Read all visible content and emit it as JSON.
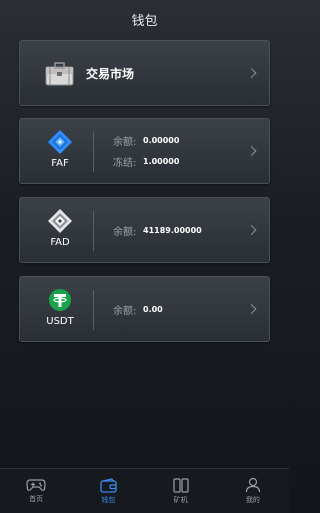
{
  "header": {
    "title": "钱包"
  },
  "market": {
    "title": "交易市场",
    "icon": "briefcase-icon"
  },
  "coins": [
    {
      "name": "FAF",
      "icon": "faf-logo",
      "balance_label": "余额:",
      "balance": "0.00000",
      "frozen_label": "冻结:",
      "frozen": "1.00000",
      "color": "#2f8fff"
    },
    {
      "name": "FAD",
      "icon": "fad-logo",
      "balance_label": "余额:",
      "balance": "41189.00000",
      "color": "#d8dadd"
    },
    {
      "name": "USDT",
      "icon": "tether-logo",
      "balance_label": "余额:",
      "balance": "0.00",
      "color": "#1aa34a"
    }
  ],
  "tabbar": {
    "items": [
      {
        "label": "首页",
        "icon": "gamepad-icon"
      },
      {
        "label": "钱包",
        "icon": "wallet-icon",
        "active": true
      },
      {
        "label": "矿机",
        "icon": "book-icon"
      },
      {
        "label": "我的",
        "icon": "user-icon"
      }
    ],
    "active_color": "#3b8bf0"
  }
}
